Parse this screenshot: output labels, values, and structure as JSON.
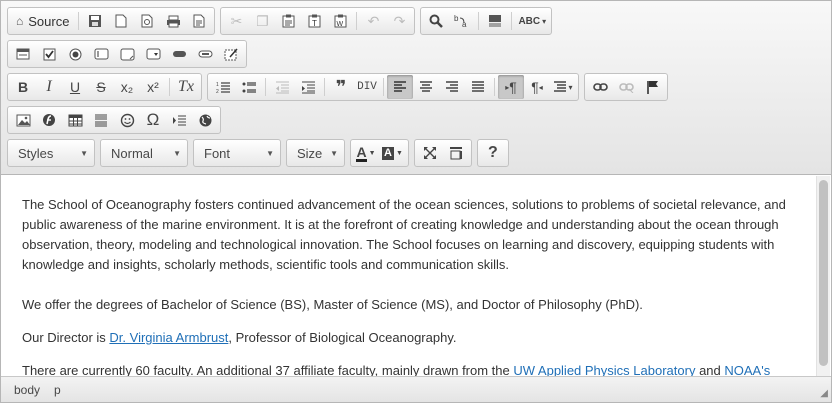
{
  "toolbar": {
    "row1": {
      "source_label": "Source",
      "buttons": [
        "save-icon",
        "new-page-icon",
        "preview-icon",
        "print-icon",
        "templates-icon",
        "cut-icon",
        "copy-icon",
        "paste-icon",
        "paste-text-icon",
        "paste-word-icon",
        "undo-icon",
        "redo-icon",
        "find-icon",
        "replace-icon",
        "select-all-icon",
        "spellcheck-icon"
      ]
    },
    "row2": {
      "buttons": [
        "form-icon",
        "checkbox-icon",
        "radio-icon",
        "text-field-icon",
        "textarea-icon",
        "select-icon",
        "button-icon",
        "image-button-icon",
        "hidden-field-icon"
      ]
    },
    "row3": {
      "bold": "B",
      "italic": "I",
      "underline": "U",
      "strike": "S",
      "subscript": "x₂",
      "superscript": "x²",
      "remove_format": "Tx",
      "blockquote": "❞",
      "div": "DIV",
      "active": [
        "align-left",
        "ltr"
      ]
    },
    "row5": {
      "styles_label": "Styles",
      "format_label": "Normal",
      "font_label": "Font",
      "size_label": "Size",
      "text_color_label": "A",
      "bg_color_label": "A",
      "help_label": "?"
    }
  },
  "content": {
    "p1": "The School of Oceanography fosters continued advancement of the ocean sciences, solutions to problems of societal relevance, and public awareness of the marine environment. It is at the forefront of creating knowledge and understanding about the ocean through observation, theory, modeling and technological innovation. The School focuses on learning and discovery, equipping students with knowledge and insights, scholarly methods, scientific tools and communication skills.",
    "p2": "We offer the degrees of Bachelor of Science (BS), Master of Science (MS), and Doctor of Philosophy (PhD).",
    "p3_pre": "Our Director is ",
    "p3_link": "Dr. Virginia Armbrust",
    "p3_post": ", Professor of Biological Oceanography.",
    "p4_pre": "There are currently 60 faculty. An additional 37 affiliate faculty, mainly drawn from the ",
    "p4_link1": "UW Applied Physics Laboratory",
    "p4_mid": " and ",
    "p4_link2": "NOAA's"
  },
  "statusbar": {
    "path1": "body",
    "path2": "p"
  }
}
